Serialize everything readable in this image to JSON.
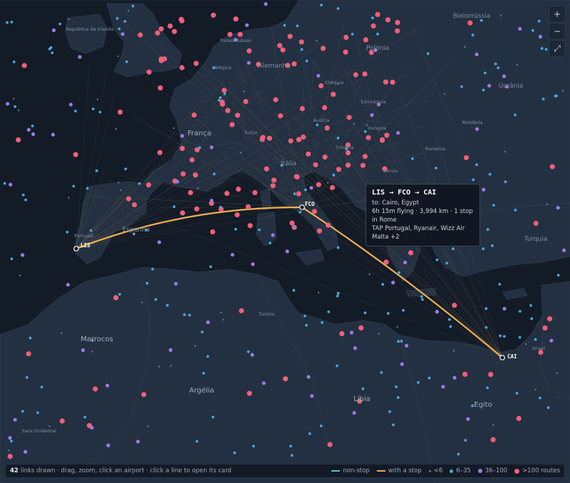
{
  "map": {
    "countries": [
      {
        "name": "Bielorrússia",
        "cls": "mid"
      },
      {
        "name": "República da Irlanda",
        "cls": "sml"
      },
      {
        "name": "Países Baixos",
        "cls": "sml"
      },
      {
        "name": "Polónia",
        "cls": "mid"
      },
      {
        "name": "Alemanha",
        "cls": "mid"
      },
      {
        "name": "Bélgica",
        "cls": "sml"
      },
      {
        "name": "Ucrânia",
        "cls": "mid"
      },
      {
        "name": "Chéquia",
        "cls": "sml"
      },
      {
        "name": "Eslováquia",
        "cls": "sml"
      },
      {
        "name": "França",
        "cls": "big"
      },
      {
        "name": "Áustria",
        "cls": "sml"
      },
      {
        "name": "Hungria",
        "cls": "sml"
      },
      {
        "name": "Moldávia",
        "cls": "sml"
      },
      {
        "name": "Suíça",
        "cls": "sml"
      },
      {
        "name": "Croácia",
        "cls": "sml"
      },
      {
        "name": "Roménia",
        "cls": "sml"
      },
      {
        "name": "Itália",
        "cls": "mid"
      },
      {
        "name": "Sérvia",
        "cls": "sml"
      },
      {
        "name": "Portugal",
        "cls": "sml"
      },
      {
        "name": "Espanha",
        "cls": "mid"
      },
      {
        "name": "Turquia",
        "cls": "mid"
      },
      {
        "name": "Tunísia",
        "cls": "sml"
      },
      {
        "name": "Marrocos",
        "cls": "big"
      },
      {
        "name": "Israel",
        "cls": "sml"
      },
      {
        "name": "Argélia",
        "cls": "big"
      },
      {
        "name": "Líbia",
        "cls": "big"
      },
      {
        "name": "Egito",
        "cls": "big"
      },
      {
        "name": "Sara Ocidental",
        "cls": "sml"
      }
    ],
    "route": {
      "codes": [
        "LIS",
        "FCO",
        "CAI"
      ],
      "color": "#f2b04e"
    },
    "fan_line_color": "#d9b27a"
  },
  "controls": {
    "zoom_in": "+",
    "zoom_out": "−",
    "fullscreen": "⤢"
  },
  "tooltip": {
    "title": "LIS → FCO → CAI",
    "to": "to: Cairo, Egypt",
    "details": "6h 15m flying · 3,994 km · 1 stop in Rome",
    "airlines": "TAP Portugal, Ryanair, Wizz Air Malta +2"
  },
  "footer": {
    "count": "42",
    "text": "links drawn · drag, zoom, click an airport · click a line to open its card",
    "legend": {
      "nonstop": {
        "label": "non-stop",
        "color": "#4fc3e8"
      },
      "onestop": {
        "label": "with a stop",
        "color": "#f2a652"
      },
      "small": {
        "label": "<6",
        "color": "#6e7c8e"
      },
      "medium": {
        "label": "6–35",
        "color": "#4aa8e0"
      },
      "large": {
        "label": "36–100",
        "color": "#9b7be6"
      },
      "huge": {
        "label": ">100 routes",
        "color": "#f0607a"
      }
    }
  }
}
